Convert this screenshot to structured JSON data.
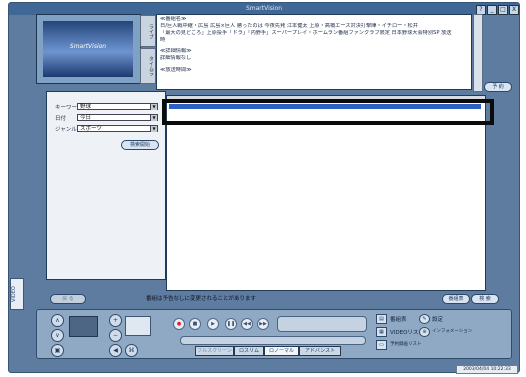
{
  "window": {
    "title": "SmartVision",
    "btn_help": "?",
    "btn_min": "_",
    "btn_restore": "□",
    "btn_close": "X"
  },
  "preview": {
    "logo_text": "SmartVision"
  },
  "side_tabs": {
    "tab1": "ライブ",
    "tab2": "タイムラ"
  },
  "info": {
    "section1": "≪番組名≫",
    "line1": "日/巨人戦中継・広島 広島×巨人 勝ったのは 今夜先発 江本健太 上原・高橋エース対決打撃陣・イチロー・松井",
    "line2": "「最大の見どころ」上原投手「ドラ」「内野手」スーパープレイ・ホームラン番組ファンクラブ限定 日本野球大会特別SP 放送",
    "line3": "時",
    "section2": "≪詳細情報≫",
    "detail": "詳細情報なし",
    "section3": "≪放送時間≫"
  },
  "reserve_button": "予 約",
  "search": {
    "keyword_label": "キーワード",
    "keyword_value": "野球",
    "date_label": "日付",
    "date_value": "今日",
    "genre_label": "ジャンル",
    "genre_value": "スポーツ",
    "start_button": "検索開始"
  },
  "video_tab": "VIDEO",
  "status": {
    "left_button": "戻 る",
    "message": "番組は予告なしに変更されることがあります",
    "btn_list": "番組表",
    "btn_search": "検 索"
  },
  "bottom": {
    "menu1": "番組表",
    "menu2": "設定",
    "menu3": "VIDEOリスト",
    "menu4": "インフォメーション",
    "menu5": "予約録画リスト",
    "mode1": "フルスクリーン",
    "mode2": "ロスリム",
    "mode3": "ロノーマル",
    "mode4": "アドバンスト"
  },
  "clock": "2003/04/04 10:22:33"
}
